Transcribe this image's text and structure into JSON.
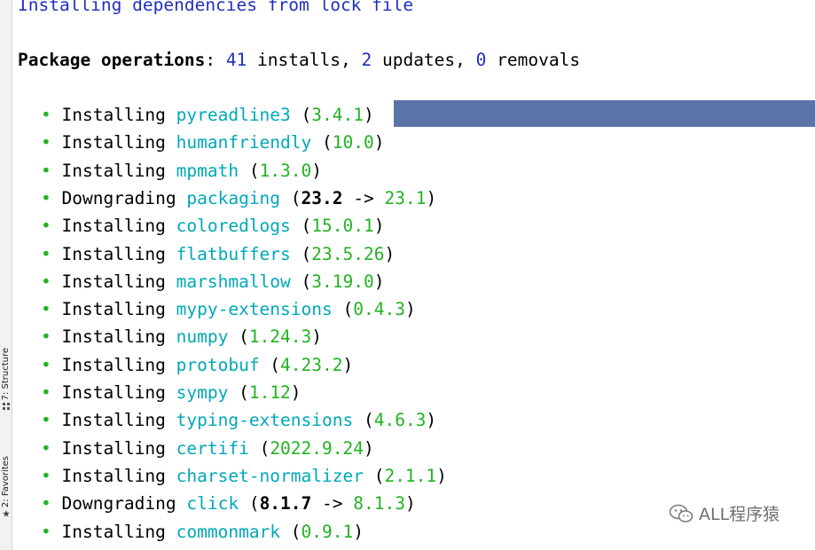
{
  "sidebar": {
    "tabs": [
      {
        "label": "7: Structure",
        "icon": "structure-icon"
      },
      {
        "label": "2: Favorites",
        "icon": "star-icon"
      }
    ]
  },
  "terminal": {
    "header": "Installing dependencies from lock file",
    "operations": {
      "label": "Package operations",
      "installs_count": "41",
      "installs_label": "installs,",
      "updates_count": "2",
      "updates_label": "updates,",
      "removals_count": "0",
      "removals_label": "removals"
    },
    "packages": [
      {
        "action": "Installing",
        "name": "pyreadline3",
        "from": "",
        "version": "3.4.1"
      },
      {
        "action": "Installing",
        "name": "humanfriendly",
        "from": "",
        "version": "10.0"
      },
      {
        "action": "Installing",
        "name": "mpmath",
        "from": "",
        "version": "1.3.0"
      },
      {
        "action": "Downgrading",
        "name": "packaging",
        "from": "23.2",
        "version": "23.1"
      },
      {
        "action": "Installing",
        "name": "coloredlogs",
        "from": "",
        "version": "15.0.1"
      },
      {
        "action": "Installing",
        "name": "flatbuffers",
        "from": "",
        "version": "23.5.26"
      },
      {
        "action": "Installing",
        "name": "marshmallow",
        "from": "",
        "version": "3.19.0"
      },
      {
        "action": "Installing",
        "name": "mypy-extensions",
        "from": "",
        "version": "0.4.3"
      },
      {
        "action": "Installing",
        "name": "numpy",
        "from": "",
        "version": "1.24.3"
      },
      {
        "action": "Installing",
        "name": "protobuf",
        "from": "",
        "version": "4.23.2"
      },
      {
        "action": "Installing",
        "name": "sympy",
        "from": "",
        "version": "1.12"
      },
      {
        "action": "Installing",
        "name": "typing-extensions",
        "from": "",
        "version": "4.6.3"
      },
      {
        "action": "Installing",
        "name": "certifi",
        "from": "",
        "version": "2022.9.24"
      },
      {
        "action": "Installing",
        "name": "charset-normalizer",
        "from": "",
        "version": "2.1.1"
      },
      {
        "action": "Downgrading",
        "name": "click",
        "from": "8.1.7",
        "version": "8.1.3"
      },
      {
        "action": "Installing",
        "name": "commonmark",
        "from": "",
        "version": "0.9.1"
      }
    ]
  },
  "watermark": {
    "text": "ALL程序猿",
    "icon": "wechat-icon"
  },
  "colors": {
    "package_name": "#00a8b8",
    "version": "#22b322",
    "header_blue": "#1f2fbf",
    "selection": "#5a74a8"
  }
}
